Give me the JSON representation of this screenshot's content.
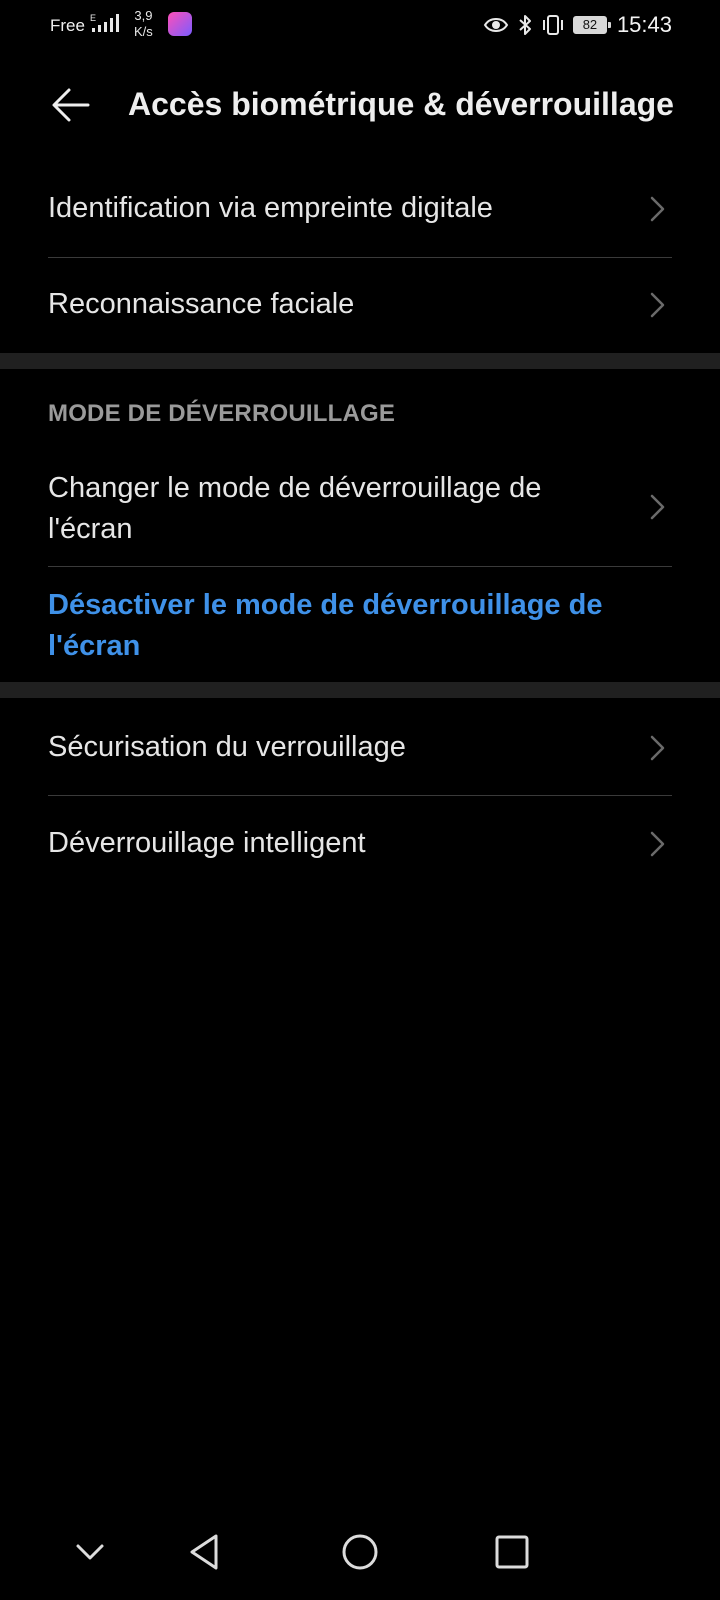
{
  "status_bar": {
    "carrier": "Free",
    "network_type": "E",
    "speed_value": "3,9",
    "speed_unit": "K/s",
    "battery": "82",
    "time": "15:43"
  },
  "header": {
    "title": "Accès biométrique & déverrouillage"
  },
  "biometrics": {
    "items": [
      {
        "label": "Identification via empreinte digitale"
      },
      {
        "label": "Reconnaissance faciale"
      }
    ]
  },
  "unlock_mode": {
    "section_title": "MODE DE DÉVERROUILLAGE",
    "change_label_line1": "Changer le mode de déverrouillage de",
    "change_label_line2": "l'écran",
    "disable_label_line1": "Désactiver le mode de déverrouillage de",
    "disable_label_line2": "l'écran"
  },
  "lock": {
    "items": [
      {
        "label": "Sécurisation du verrouillage"
      },
      {
        "label": "Déverrouillage intelligent"
      }
    ]
  },
  "colors": {
    "background": "#000000",
    "accent_link": "#3f91e8",
    "section_title": "#9a9a9a"
  },
  "icons": {
    "back": "arrow-left-icon",
    "chevron": "chevron-right-icon",
    "nav_collapse": "chevron-down-icon",
    "nav_back": "triangle-back-icon",
    "nav_home": "circle-home-icon",
    "nav_recents": "square-recents-icon"
  }
}
